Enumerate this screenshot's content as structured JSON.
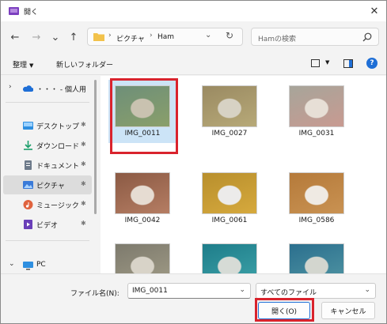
{
  "window": {
    "title": "開く"
  },
  "nav": {
    "back": "←",
    "forward": "→",
    "recent": "⌄",
    "up": "↑"
  },
  "address": {
    "crumbs": [
      "ピクチャ",
      "Ham"
    ],
    "separator": "›",
    "dropdown": "⌄",
    "refresh": "↻"
  },
  "search": {
    "placeholder": "Hamの検索"
  },
  "toolbar": {
    "organize": "整理",
    "new_folder": "新しいフォルダー",
    "help": "?"
  },
  "sidebar": {
    "items": [
      {
        "label": "・・・ - 個人用",
        "icon": "onedrive-cloud-icon",
        "pinned": false,
        "chevron": "›"
      },
      {
        "label": "デスクトップ",
        "icon": "desktop-icon",
        "pinned": true
      },
      {
        "label": "ダウンロード",
        "icon": "download-icon",
        "pinned": true
      },
      {
        "label": "ドキュメント",
        "icon": "document-icon",
        "pinned": true
      },
      {
        "label": "ピクチャ",
        "icon": "pictures-icon",
        "pinned": true,
        "selected": true
      },
      {
        "label": "ミュージック",
        "icon": "music-icon",
        "pinned": true
      },
      {
        "label": "ビデオ",
        "icon": "video-icon",
        "pinned": true
      },
      {
        "label": "PC",
        "icon": "pc-icon",
        "pinned": false,
        "chevron": "›"
      }
    ],
    "pin_glyph": "📌"
  },
  "files": [
    {
      "name": "IMG_0011",
      "selected": true,
      "colors": [
        "#6e8f79",
        "#c9c2b0",
        "#8a9f6a"
      ]
    },
    {
      "name": "IMG_0027",
      "selected": false,
      "colors": [
        "#9a8a62",
        "#d7d2c4",
        "#b7a978"
      ]
    },
    {
      "name": "IMG_0031",
      "selected": false,
      "colors": [
        "#a7a59a",
        "#e7dfd6",
        "#c89a91"
      ]
    },
    {
      "name": "IMG_0042",
      "selected": false,
      "colors": [
        "#8b5a44",
        "#e6dcd2",
        "#b57d63"
      ]
    },
    {
      "name": "IMG_0061",
      "selected": false,
      "colors": [
        "#b88f2d",
        "#ecebea",
        "#d6a93d"
      ]
    },
    {
      "name": "IMG_0586",
      "selected": false,
      "colors": [
        "#b57a3a",
        "#efeae3",
        "#c99252"
      ]
    },
    {
      "name": "",
      "selected": false,
      "colors": [
        "#7d7a6d",
        "#d8d3c8",
        "#a09b86"
      ]
    },
    {
      "name": "",
      "selected": false,
      "colors": [
        "#1e7d8a",
        "#d6dbd6",
        "#3da2a8"
      ]
    },
    {
      "name": "",
      "selected": false,
      "colors": [
        "#2b6f8e",
        "#d3d6cf",
        "#5095a3"
      ]
    }
  ],
  "footer": {
    "filename_label": "ファイル名(N):",
    "filename_value": "IMG_0011",
    "filetype_value": "すべてのファイル",
    "open_label": "開く(O)",
    "cancel_label": "キャンセル"
  },
  "colors": {
    "accent": "#1f6fd6",
    "highlight": "#d9232d",
    "selection": "#cce4f7"
  }
}
